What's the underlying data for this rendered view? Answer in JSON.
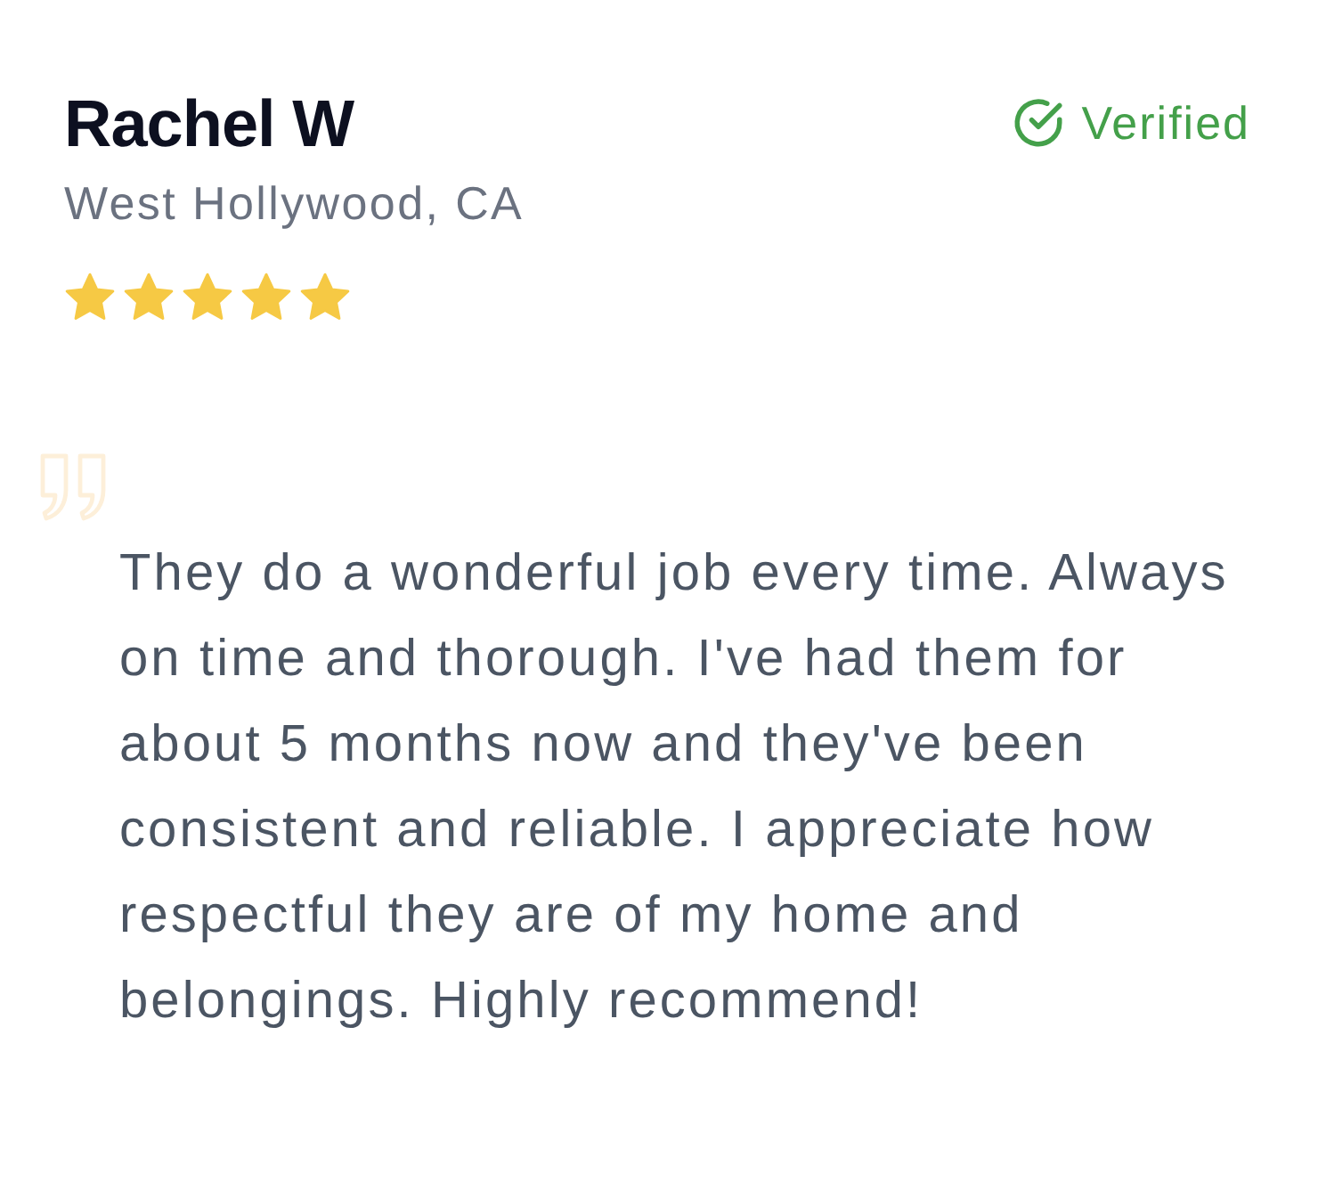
{
  "review": {
    "name": "Rachel W",
    "location": "West Hollywood, CA",
    "stars": 5,
    "badge": {
      "label": "Verified"
    },
    "text": "They do a wonderful job every time. Always on time and thorough. I've had them for about 5 months now and they've been consistent and reliable. I appreciate how respectful they are of my home and belongings. Highly recommend!"
  }
}
